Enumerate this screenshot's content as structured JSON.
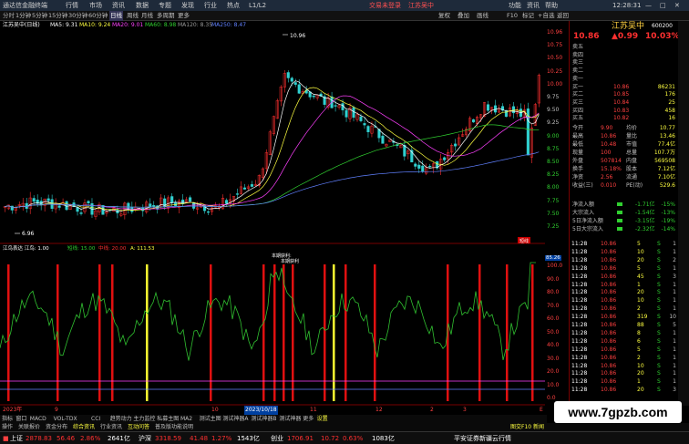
{
  "titlebar": {
    "app": "通达信金融终端",
    "menus": [
      "行情",
      "市场",
      "资讯",
      "数据",
      "专题",
      "发现",
      "行业",
      "热点",
      "L1/L2"
    ],
    "trade_login": "交易未登录",
    "stock_name": "江苏吴中",
    "right_menus": [
      "功能",
      "资讯",
      "帮助"
    ],
    "time": "12:28:31"
  },
  "toolbar": {
    "periods": [
      "分时",
      "1分钟",
      "5分钟",
      "15分钟",
      "30分钟",
      "60分钟",
      "日线",
      "周线",
      "月线",
      "多周期",
      "更多"
    ],
    "right": [
      "复权",
      "叠加",
      "画线",
      "F10",
      "标记",
      "+自选",
      "返回"
    ]
  },
  "stockline": {
    "title": "江苏吴中(日线)",
    "ma5": "MA5: 9.31",
    "ma10": "MA10: 9.24",
    "ma20": "MA20: 9.01",
    "ma60": "MA60: 8.98",
    "ma120": "MA120: 8.35",
    "ma250": "MA250: 8.47"
  },
  "chart_annotations": {
    "high": "10.96",
    "low": "6.96",
    "marker": "短线"
  },
  "indicator": {
    "title": "江鸟表达 江鸟: 1.00",
    "short": "短线: 15.00",
    "mid": "中线: 20.00",
    "a": "A: 111.53",
    "label1": "本期获利:",
    "label2": "本期获利"
  },
  "y_axis_main": [
    "10.96",
    "10.75",
    "10.50",
    "10.25",
    "10.00",
    "9.75",
    "9.50",
    "9.25",
    "9.00",
    "8.75",
    "8.50",
    "8.25",
    "8.00",
    "7.75",
    "7.50",
    "7.25"
  ],
  "y_axis_ind": [
    "100.0",
    "90.0",
    "80.0",
    "70.0",
    "60.0",
    "50.0",
    "40.0",
    "30.0",
    "20.0",
    "10.0",
    "0.0"
  ],
  "y_ind_current": "85.26",
  "x_axis": {
    "start": "2023年",
    "labels": [
      "9",
      "10",
      "11",
      "12",
      "2",
      "3"
    ],
    "date": "2023/10/18",
    "end": "E"
  },
  "quote": {
    "name": "江苏吴中",
    "code": "600200",
    "price": "10.86",
    "change": "▲0.99",
    "pct": "10.03%",
    "asks": [
      {
        "label": "卖五",
        "price": "",
        "vol": ""
      },
      {
        "label": "卖四",
        "price": "",
        "vol": ""
      },
      {
        "label": "卖三",
        "price": "",
        "vol": ""
      },
      {
        "label": "卖二",
        "price": "",
        "vol": ""
      },
      {
        "label": "卖一",
        "price": "",
        "vol": ""
      }
    ],
    "bids": [
      {
        "label": "买一",
        "price": "10.86",
        "vol": "86231"
      },
      {
        "label": "买二",
        "price": "10.85",
        "vol": "176"
      },
      {
        "label": "买三",
        "price": "10.84",
        "vol": "25"
      },
      {
        "label": "买四",
        "price": "10.83",
        "vol": "458"
      },
      {
        "label": "买五",
        "price": "10.82",
        "vol": "16"
      }
    ],
    "stats": [
      {
        "l1": "今开",
        "v1": "9.90",
        "l2": "均价",
        "v2": "10.77"
      },
      {
        "l1": "最高",
        "v1": "10.86",
        "l2": "量比",
        "v2": "13.46"
      },
      {
        "l1": "最低",
        "v1": "10.48",
        "l2": "市值",
        "v2": "77.4亿"
      },
      {
        "l1": "现量",
        "v1": "100",
        "l2": "总量",
        "v2": "107.7万"
      },
      {
        "l1": "外盘",
        "v1": "507814",
        "l2": "内盘",
        "v2": "569508"
      },
      {
        "l1": "换手",
        "v1": "15.18%",
        "l2": "股本",
        "v2": "7.12亿"
      },
      {
        "l1": "净资",
        "v1": "2.56",
        "l2": "流通",
        "v2": "7.10亿"
      },
      {
        "l1": "收益(三)",
        "v1": "0.010",
        "l2": "PE(动)",
        "v2": "529.6"
      }
    ],
    "flows": [
      {
        "label": "净流入额",
        "value": "-1.71亿",
        "pct": "-15%"
      },
      {
        "label": "大宗流入",
        "value": "-1.54亿",
        "pct": "-13%"
      },
      {
        "label": "5日净流入额",
        "value": "-3.15亿",
        "pct": "-19%"
      },
      {
        "label": "5日大宗流入",
        "value": "-2.32亿",
        "pct": "-14%"
      }
    ],
    "ticks": [
      {
        "t": "11:28",
        "p": "10.86",
        "v": "5",
        "s": "S",
        "n": "1"
      },
      {
        "t": "11:28",
        "p": "10.86",
        "v": "10",
        "s": "S",
        "n": "1"
      },
      {
        "t": "11:28",
        "p": "10.86",
        "v": "20",
        "s": "S",
        "n": "2"
      },
      {
        "t": "11:28",
        "p": "10.86",
        "v": "5",
        "s": "S",
        "n": "1"
      },
      {
        "t": "11:28",
        "p": "10.86",
        "v": "45",
        "s": "S",
        "n": "3"
      },
      {
        "t": "11:28",
        "p": "10.86",
        "v": "1",
        "s": "S",
        "n": "1"
      },
      {
        "t": "11:28",
        "p": "10.86",
        "v": "20",
        "s": "S",
        "n": "1"
      },
      {
        "t": "11:28",
        "p": "10.86",
        "v": "10",
        "s": "S",
        "n": "1"
      },
      {
        "t": "11:28",
        "p": "10.86",
        "v": "2",
        "s": "S",
        "n": "1"
      },
      {
        "t": "11:28",
        "p": "10.86",
        "v": "319",
        "s": "S",
        "n": "10"
      },
      {
        "t": "11:28",
        "p": "10.86",
        "v": "88",
        "s": "S",
        "n": "5"
      },
      {
        "t": "11:28",
        "p": "10.86",
        "v": "8",
        "s": "S",
        "n": "1"
      },
      {
        "t": "11:28",
        "p": "10.86",
        "v": "6",
        "s": "S",
        "n": "1"
      },
      {
        "t": "11:28",
        "p": "10.86",
        "v": "5",
        "s": "S",
        "n": "1"
      },
      {
        "t": "11:28",
        "p": "10.86",
        "v": "2",
        "s": "S",
        "n": "1"
      },
      {
        "t": "11:28",
        "p": "10.86",
        "v": "10",
        "s": "S",
        "n": "1"
      },
      {
        "t": "11:28",
        "p": "10.86",
        "v": "20",
        "s": "S",
        "n": "1"
      },
      {
        "t": "11:28",
        "p": "10.86",
        "v": "1",
        "s": "S",
        "n": "1"
      },
      {
        "t": "11:28",
        "p": "10.86",
        "v": "20",
        "s": "S",
        "n": "3"
      }
    ]
  },
  "tabs": [
    "指标",
    "窗口",
    "MACD",
    "VOL-TDX",
    "CCI",
    "趋势动力",
    "主力监控",
    "私募主图",
    "MA2",
    "测试主图",
    "测试神器A",
    "测试神器B",
    "测试神器",
    "更多",
    "设置"
  ],
  "subtabs": [
    "操作",
    "关联报价",
    "资金分布",
    "综合资讯",
    "行业资讯",
    "互动问答",
    "普及版功能说明"
  ],
  "subtab_right": "图交F10 新闻",
  "status": {
    "sh_label": "上证",
    "sh_val": "2878.83",
    "sh_chg": "56.46",
    "sh_pct": "2.86%",
    "sh_amt": "2641亿",
    "sz_label": "沪深",
    "sz_val": "3318.59",
    "sz_chg": "41.48",
    "sz_pct": "1.27%",
    "sz_amt": "1543亿",
    "cy_label": "创业",
    "cy_val": "1706.91",
    "cy_chg": "10.72",
    "cy_pct": "0.63%",
    "cy_amt": "1083亿",
    "news": "平安证券新疆云行情"
  },
  "watermark": "www.7gpzb.com",
  "colors": {
    "up": "#ff3030",
    "down": "#30d030",
    "ma5": "#ffffff",
    "ma10": "#ffff40",
    "ma20": "#ff40ff",
    "ma60": "#30d030",
    "ma120": "#6080ff"
  }
}
